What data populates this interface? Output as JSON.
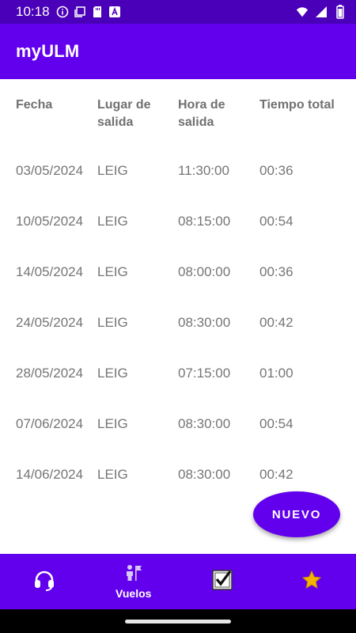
{
  "status_bar": {
    "time": "10:18",
    "left_icons": [
      "info-icon",
      "screenshot-icon",
      "sd-card-icon",
      "font-a-icon"
    ],
    "right_icons": [
      "wifi-icon",
      "signal-icon",
      "battery-icon"
    ]
  },
  "app_bar": {
    "title": "myULM"
  },
  "table": {
    "headers": [
      "Fecha",
      "Lugar de salida",
      "Hora de salida",
      "Tiempo total"
    ],
    "rows": [
      [
        "03/05/2024",
        "LEIG",
        "11:30:00",
        "00:36"
      ],
      [
        "10/05/2024",
        "LEIG",
        "08:15:00",
        "00:54"
      ],
      [
        "14/05/2024",
        "LEIG",
        "08:00:00",
        "00:36"
      ],
      [
        "24/05/2024",
        "LEIG",
        "08:30:00",
        "00:42"
      ],
      [
        "28/05/2024",
        "LEIG",
        "07:15:00",
        "01:00"
      ],
      [
        "07/06/2024",
        "LEIG",
        "08:30:00",
        "00:54"
      ],
      [
        "14/06/2024",
        "LEIG",
        "08:30:00",
        "00:42"
      ]
    ]
  },
  "fab": {
    "label": "NUEVO"
  },
  "bottom_nav": {
    "items": [
      {
        "icon": "headset-icon",
        "label": ""
      },
      {
        "icon": "pilot-flag-icon",
        "label": "Vuelos"
      },
      {
        "icon": "checkbox-icon",
        "label": ""
      },
      {
        "icon": "star-icon",
        "label": ""
      }
    ]
  },
  "colors": {
    "primary": "#6200ee",
    "status_bar": "#4a00b8",
    "text_gray": "#757575",
    "star": "#f5b400"
  }
}
